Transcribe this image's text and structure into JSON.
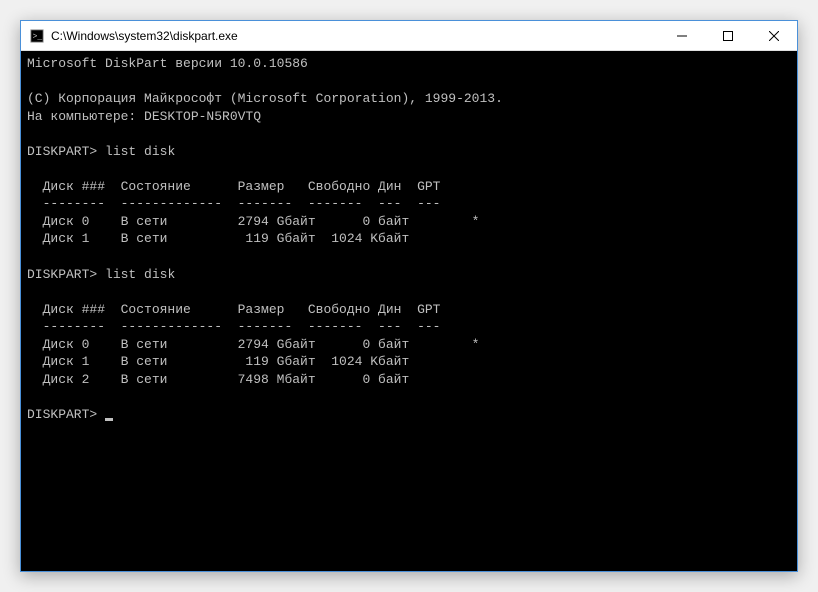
{
  "window": {
    "title": "C:\\Windows\\system32\\diskpart.exe"
  },
  "terminal": {
    "header_line": "Microsoft DiskPart версии 10.0.10586",
    "copyright": "(C) Корпорация Майкрософт (Microsoft Corporation), 1999-2013.",
    "computer": "На компьютере: DESKTOP-N5R0VTQ",
    "prompt": "DISKPART>",
    "command1": "list disk",
    "table1_header": "  Диск ###  Состояние      Размер   Свободно Дин  GPT",
    "table1_divider": "  --------  -------------  -------  -------  ---  ---",
    "table1_row0": "  Диск 0    В сети         2794 Gбайт      0 байт        *",
    "table1_row1": "  Диск 1    В сети          119 Gбайт  1024 Kбайт",
    "command2": "list disk",
    "table2_header": "  Диск ###  Состояние      Размер   Свободно Дин  GPT",
    "table2_divider": "  --------  -------------  -------  -------  ---  ---",
    "table2_row0": "  Диск 0    В сети         2794 Gбайт      0 байт        *",
    "table2_row1": "  Диск 1    В сети          119 Gбайт  1024 Kбайт",
    "table2_row2": "  Диск 2    В сети         7498 Mбайт      0 байт"
  }
}
